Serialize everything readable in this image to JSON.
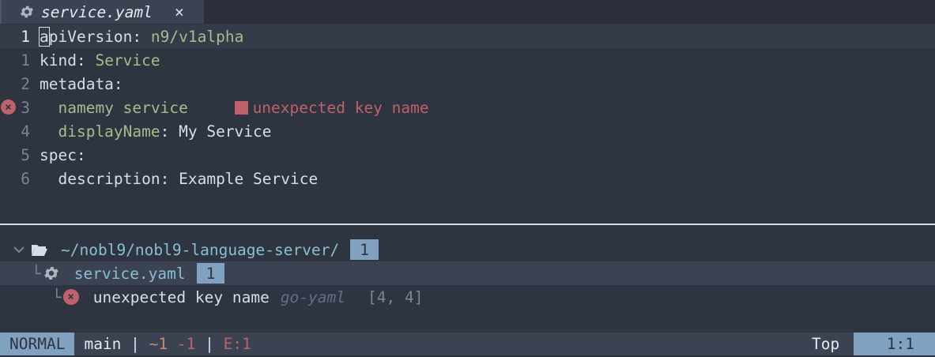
{
  "tab": {
    "title": "service.yaml",
    "close": "×",
    "icon": "gear-icon"
  },
  "editor": {
    "lines": [
      {
        "num": "1",
        "key": "apiVersion",
        "sep": ": ",
        "value": "n9/v1alpha"
      },
      {
        "num": "1",
        "key": "kind",
        "sep": ": ",
        "value": "Service"
      },
      {
        "num": "2",
        "key": "metadata",
        "sep": ":",
        "value": ""
      },
      {
        "num": "3",
        "indent": "  ",
        "text": "namemy service",
        "diagnostic": "unexpected key name"
      },
      {
        "num": "4",
        "indent": "  ",
        "key": "displayName",
        "sep": ": ",
        "value": "My Service"
      },
      {
        "num": "5",
        "key": "spec",
        "sep": ":",
        "value": ""
      },
      {
        "num": "6",
        "indent": "  ",
        "key": "description",
        "sep": ": ",
        "value": "Example Service"
      }
    ]
  },
  "tree": {
    "folder": {
      "path": "~/nobl9/nobl9-language-server/",
      "count": "1",
      "chevron": "chevron-down-icon",
      "icon": "folder-open-icon"
    },
    "file": {
      "name": "service.yaml",
      "count": "1",
      "icon": "gear-icon"
    },
    "diagnostic": {
      "message": "unexpected key name",
      "source": "go-yaml",
      "position": "[4, 4]"
    }
  },
  "statusline": {
    "mode": "NORMAL",
    "branch": "main",
    "sep": " | ",
    "modified": "~1",
    "deleted": "-1",
    "errors": "E:1",
    "scroll": "Top",
    "position": "1:1"
  },
  "colors": {
    "background": "#2e3440",
    "accent": "#81a1c1",
    "error": "#bf616a",
    "string": "#a3be8c",
    "path": "#88c0d0"
  }
}
